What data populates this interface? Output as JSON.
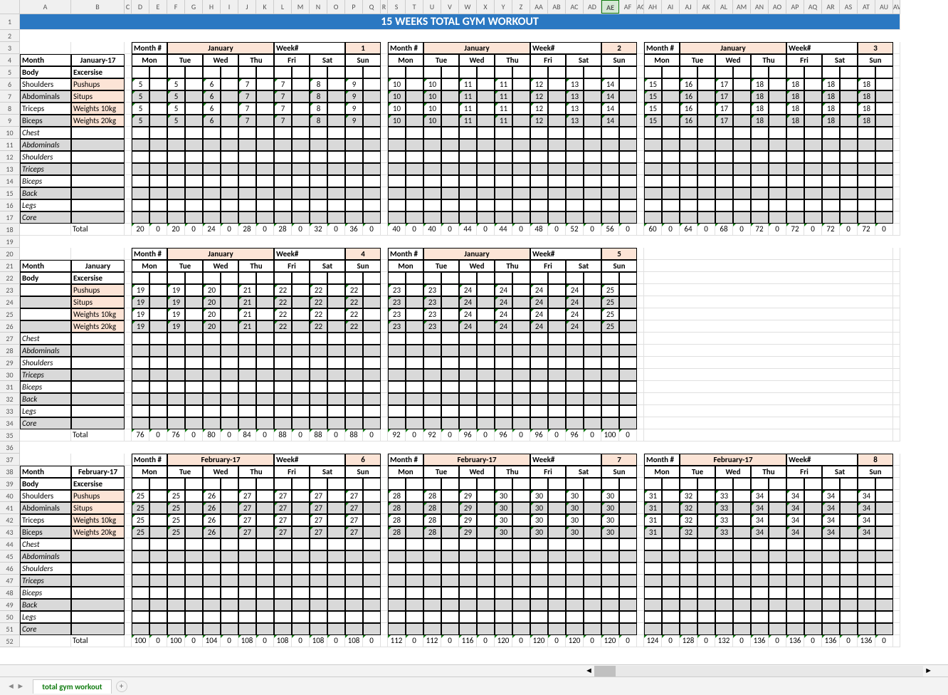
{
  "title": "15 WEEKS TOTAL GYM WORKOUT",
  "cols": [
    "A",
    "B",
    "C",
    "D",
    "E",
    "F",
    "G",
    "H",
    "I",
    "J",
    "K",
    "L",
    "M",
    "N",
    "O",
    "P",
    "Q",
    "R",
    "S",
    "T",
    "U",
    "V",
    "W",
    "X",
    "Y",
    "Z",
    "AA",
    "AB",
    "AC",
    "AD",
    "AE",
    "AF",
    "AG",
    "AH",
    "AI",
    "AJ",
    "AK",
    "AL",
    "AM",
    "AN",
    "AO",
    "AP",
    "AQ",
    "AR",
    "AS",
    "AT",
    "AU",
    "AV"
  ],
  "selColIdx": 30,
  "sheet": "total gym workout",
  "labels": {
    "month": "Month",
    "monthn": "Month #",
    "week": "Week#",
    "body": "Body",
    "exc": "Excersise",
    "total": "Total",
    "jan": "January",
    "jan17": "January-17",
    "feb17": "February-17"
  },
  "days": [
    "Mon",
    "Tue",
    "Wed",
    "Thu",
    "Fri",
    "Sat",
    "Sun"
  ],
  "bodies": [
    "Shoulders",
    "Abdominals",
    "Triceps",
    "Biceps",
    "Chest",
    "Abdominals",
    "Shoulders",
    "Triceps",
    "Biceps",
    "Back",
    "Legs",
    "Core"
  ],
  "exs": [
    "Pushups",
    "Situps",
    "Weights 10kg",
    "Weights 20kg"
  ],
  "blocks": [
    {
      "monthLabel": "January-17",
      "weeks": [
        {
          "n": 1,
          "mv": "January",
          "v": [
            [
              5,
              5,
              6,
              7,
              7,
              8,
              9
            ],
            [
              5,
              5,
              6,
              7,
              7,
              8,
              9
            ],
            [
              5,
              5,
              6,
              7,
              7,
              8,
              9
            ],
            [
              5,
              5,
              6,
              7,
              7,
              8,
              9
            ]
          ],
          "t": [
            20,
            20,
            24,
            28,
            28,
            32,
            36
          ]
        },
        {
          "n": 2,
          "mv": "January",
          "v": [
            [
              10,
              10,
              11,
              11,
              12,
              13,
              14
            ],
            [
              10,
              10,
              11,
              11,
              12,
              13,
              14
            ],
            [
              10,
              10,
              11,
              11,
              12,
              13,
              14
            ],
            [
              10,
              10,
              11,
              11,
              12,
              13,
              14
            ]
          ],
          "t": [
            40,
            40,
            44,
            44,
            48,
            52,
            56
          ]
        },
        {
          "n": 3,
          "mv": "January",
          "v": [
            [
              15,
              16,
              17,
              18,
              18,
              18,
              18
            ],
            [
              15,
              16,
              17,
              18,
              18,
              18,
              18
            ],
            [
              15,
              16,
              17,
              18,
              18,
              18,
              18
            ],
            [
              15,
              16,
              17,
              18,
              18,
              18,
              18
            ]
          ],
          "t": [
            60,
            64,
            68,
            72,
            72,
            72,
            72
          ]
        }
      ]
    },
    {
      "monthLabel": "January",
      "weeks": [
        {
          "n": 4,
          "mv": "January",
          "v": [
            [
              19,
              19,
              20,
              21,
              22,
              22,
              22
            ],
            [
              19,
              19,
              20,
              21,
              22,
              22,
              22
            ],
            [
              19,
              19,
              20,
              21,
              22,
              22,
              22
            ],
            [
              19,
              19,
              20,
              21,
              22,
              22,
              22
            ]
          ],
          "t": [
            76,
            76,
            80,
            84,
            88,
            88,
            88
          ]
        },
        {
          "n": 5,
          "mv": "January",
          "v": [
            [
              23,
              23,
              24,
              24,
              24,
              24,
              25
            ],
            [
              23,
              23,
              24,
              24,
              24,
              24,
              25
            ],
            [
              23,
              23,
              24,
              24,
              24,
              24,
              25
            ],
            [
              23,
              23,
              24,
              24,
              24,
              24,
              25
            ]
          ],
          "t": [
            92,
            92,
            96,
            96,
            96,
            96,
            100
          ]
        }
      ]
    },
    {
      "monthLabel": "February-17",
      "weeks": [
        {
          "n": 6,
          "mv": "February-17",
          "v": [
            [
              25,
              25,
              26,
              27,
              27,
              27,
              27
            ],
            [
              25,
              25,
              26,
              27,
              27,
              27,
              27
            ],
            [
              25,
              25,
              26,
              27,
              27,
              27,
              27
            ],
            [
              25,
              25,
              26,
              27,
              27,
              27,
              27
            ]
          ],
          "t": [
            100,
            100,
            104,
            108,
            108,
            108,
            108
          ]
        },
        {
          "n": 7,
          "mv": "February-17",
          "v": [
            [
              28,
              28,
              29,
              30,
              30,
              30,
              30
            ],
            [
              28,
              28,
              29,
              30,
              30,
              30,
              30
            ],
            [
              28,
              28,
              29,
              30,
              30,
              30,
              30
            ],
            [
              28,
              28,
              29,
              30,
              30,
              30,
              30
            ]
          ],
          "t": [
            112,
            112,
            116,
            120,
            120,
            120,
            120
          ]
        },
        {
          "n": 8,
          "mv": "February-17",
          "v": [
            [
              31,
              32,
              33,
              34,
              34,
              34,
              34
            ],
            [
              31,
              32,
              33,
              34,
              34,
              34,
              34
            ],
            [
              31,
              32,
              33,
              34,
              34,
              34,
              34
            ],
            [
              31,
              32,
              33,
              34,
              34,
              34,
              34
            ]
          ],
          "t": [
            124,
            128,
            132,
            136,
            136,
            136,
            136
          ]
        }
      ]
    }
  ]
}
